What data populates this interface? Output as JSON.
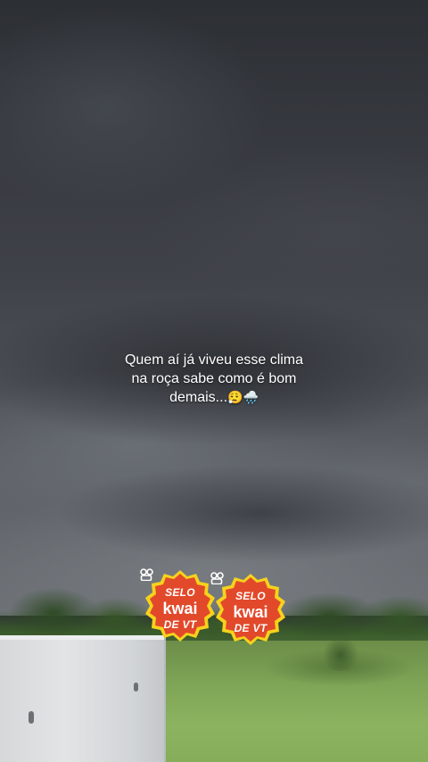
{
  "caption": {
    "line1": "Quem aí já viveu esse clima",
    "line2": "na roça sabe como é bom",
    "line3": "demais...",
    "emoji": "😮‍💨🌧️"
  },
  "badges": [
    {
      "top": "SELO",
      "brand": "kwai",
      "bottom": "DE VT"
    },
    {
      "top": "SELO",
      "brand": "kwai",
      "bottom": "DE VT"
    }
  ],
  "colors": {
    "badge_fill": "#e2492b",
    "badge_border": "#f7d21c"
  }
}
